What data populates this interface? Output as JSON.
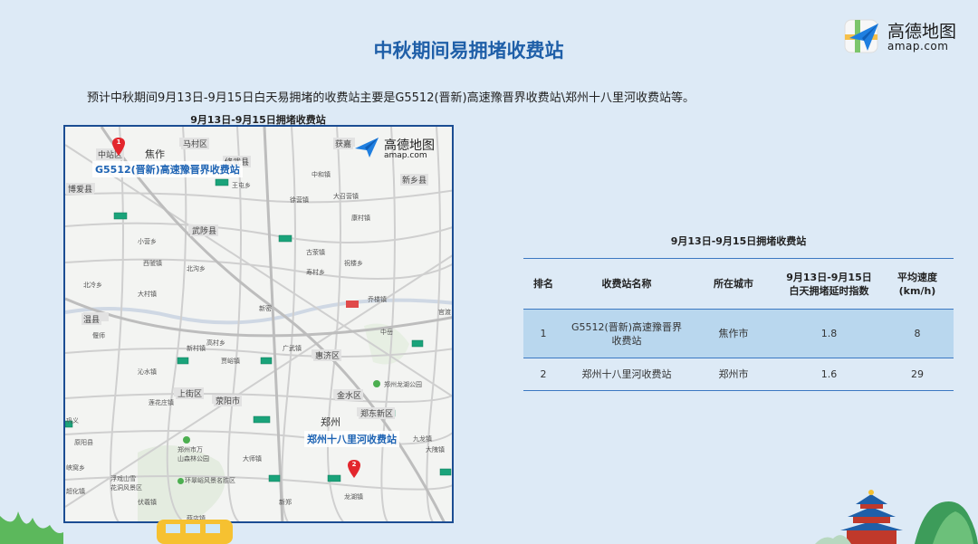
{
  "header": {
    "title": "中秋期间易拥堵收费站",
    "logo_name": "高德地图",
    "logo_domain": "amap.com"
  },
  "intro_text": "预计中秋期间9月13日-9月15日白天易拥堵的收费站主要是G5512(晋新)高速豫晋界收费站\\郑州十八里河收费站等。",
  "map": {
    "caption": "9月13日-9月15日拥堵收费站",
    "logo_name": "高德地图",
    "logo_domain": "amap.com",
    "callouts": [
      {
        "pin": "1",
        "label": "G5512(晋新)高速豫晋界收费站"
      },
      {
        "pin": "2",
        "label": "郑州十八里河收费站"
      }
    ],
    "places": {
      "jiaozuo": "焦作",
      "zhongzhan": "中站区",
      "macun": "马村区",
      "xiuwu": "修武县",
      "huojia": "获嘉",
      "boai": "博爱县",
      "wangzhen": "王屯乡",
      "wuzhi": "武陟县",
      "xinxiang": "新乡县",
      "zhonghe": "中和镇",
      "dazhaoying": "大召营镇",
      "kanghe": "康村镇",
      "yangzhuang": "徐营镇",
      "wenxian": "温县",
      "xiaoyi": "小营乡",
      "xiguo": "西虢镇",
      "beiqing": "北冷乡",
      "beigou": "北沟乡",
      "dacun": "大村镇",
      "yanshi": "偃师",
      "shangjie": "上街区",
      "xingyang": "荥阳市",
      "huiji": "惠济区",
      "jinshui": "金水区",
      "zhengzhou": "郑州",
      "zhengdong": "郑东新区",
      "longhu": "郑州龙湖公园",
      "yuanyang": "原阳县",
      "guangwu": "广武镇",
      "gucheng": "古荥镇",
      "lanyang": "乔楼镇",
      "qinglong": "祝楼乡",
      "kaifang": "薛店镇",
      "zhongmou": "官渡",
      "xinzheng": "新郑",
      "jiu": "九龙镇",
      "daizhuang": "大隗镇",
      "gongyi": "巩义",
      "shangfen": "沁水镇",
      "dashi": "大师镇",
      "yingze": "莲花庄镇",
      "xinmi": "新密",
      "zhongyue": "中岳",
      "senlin_1": "郑州市万",
      "senlin_2": "山森林公园",
      "huanlou": "环翠峪风景名胜区",
      "fuxi_1": "浮戏山雪",
      "fuxi_2": "花洞风景区",
      "yuzhai": "峡窝乡",
      "chaohua": "超化镇",
      "fudian": "伏羲镇",
      "jiacun": "贾峪镇",
      "longhu_town": "龙湖镇",
      "xiwang": "新村镇",
      "shoushang": "寿村乡",
      "gaocheng": "高村乡"
    }
  },
  "table": {
    "caption": "9月13日-9月15日拥堵收费站",
    "headers": {
      "rank": "排名",
      "name": "收费站名称",
      "city": "所在城市",
      "index_line1": "9月13日-9月15日",
      "index_line2": "白天拥堵延时指数",
      "speed_line1": "平均速度",
      "speed_line2": "(km/h)"
    },
    "rows": [
      {
        "rank": "1",
        "name_line1": "G5512(晋新)高速豫晋界",
        "name_line2": "收费站",
        "city": "焦作市",
        "index": "1.8",
        "speed": "8"
      },
      {
        "rank": "2",
        "name_line1": "郑州十八里河收费站",
        "name_line2": "",
        "city": "郑州市",
        "index": "1.6",
        "speed": "29"
      }
    ]
  },
  "colors": {
    "background": "#ddeaf6",
    "title": "#1f5fa8",
    "table_highlight": "#b9d7ee",
    "map_border": "#1b4d93",
    "pin": "#e3262d",
    "toll_marker": "#1aa37a"
  },
  "icons": [
    "amap-logo-icon",
    "map-pin-icon",
    "toll-station-icon",
    "temple-decoration-icon",
    "bus-decoration-icon"
  ]
}
